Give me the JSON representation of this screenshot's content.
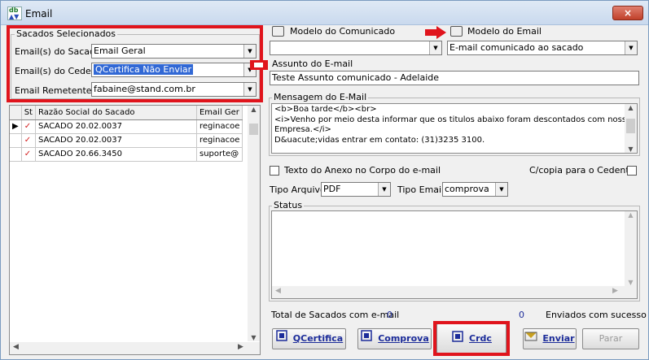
{
  "window": {
    "title": "Email",
    "close_label": "×"
  },
  "sacados": {
    "group_label": "Sacados Selecionados",
    "email_sacado_label": "Email(s) do Sacado",
    "email_sacado_value": "Email Geral",
    "email_cedente_label": "Email(s) do Cedente",
    "email_cedente_value": "QCertifica Não Enviar",
    "email_remetente_label": "Email Remetente",
    "email_remetente_value": "fabaine@stand.com.br"
  },
  "grid": {
    "columns": [
      "St",
      "Razão Social do Sacado",
      "Email Ger"
    ],
    "rows": [
      {
        "st": "✓",
        "razao": "SACADO 20.02.0037",
        "email": "reginacoe",
        "current": true
      },
      {
        "st": "✓",
        "razao": "SACADO 20.02.0037",
        "email": "reginacoe",
        "current": false
      },
      {
        "st": "✓",
        "razao": "SACADO 20.66.3450",
        "email": "suporte@",
        "current": false
      }
    ]
  },
  "modelo_comunicado": {
    "label": "Modelo do Comunicado",
    "value": ""
  },
  "modelo_email": {
    "label": "Modelo do Email",
    "value": "E-mail comunicado ao sacado"
  },
  "assunto": {
    "label": "Assunto do E-mail",
    "value": "Teste Assunto comunicado - Adelaide"
  },
  "mensagem": {
    "label": "Mensagem do E-Mail",
    "lines": [
      "<b>Boa tarde</b><br>",
      "<i>Venho por meio desta informar que os titulos abaixo foram descontados com nossa",
      "Empresa.</i>",
      "D&uacute;vidas entrar em contato: (31)3235 3100."
    ]
  },
  "anexo_label": "Texto do Anexo no Corpo do e-mail",
  "copia_label": "C/copia para o Cedente",
  "tipo_arquivo": {
    "label": "Tipo Arquivo",
    "value": "PDF"
  },
  "tipo_email": {
    "label": "Tipo Email",
    "value": "comprova"
  },
  "status_label": "Status",
  "footer": {
    "total_label": "Total de Sacados com e-mail",
    "total_value": "0",
    "enviados_value": "0",
    "enviados_label": "Enviados com sucesso"
  },
  "buttons": {
    "qcertifica": "QCertifica",
    "comprova": "Comprova",
    "crdc": "Crdc",
    "enviar": "Enviar",
    "parar": "Parar"
  },
  "colors": {
    "highlight_red": "#e0141c",
    "selection_blue": "#3168d5",
    "check_red": "#d21c1c"
  }
}
